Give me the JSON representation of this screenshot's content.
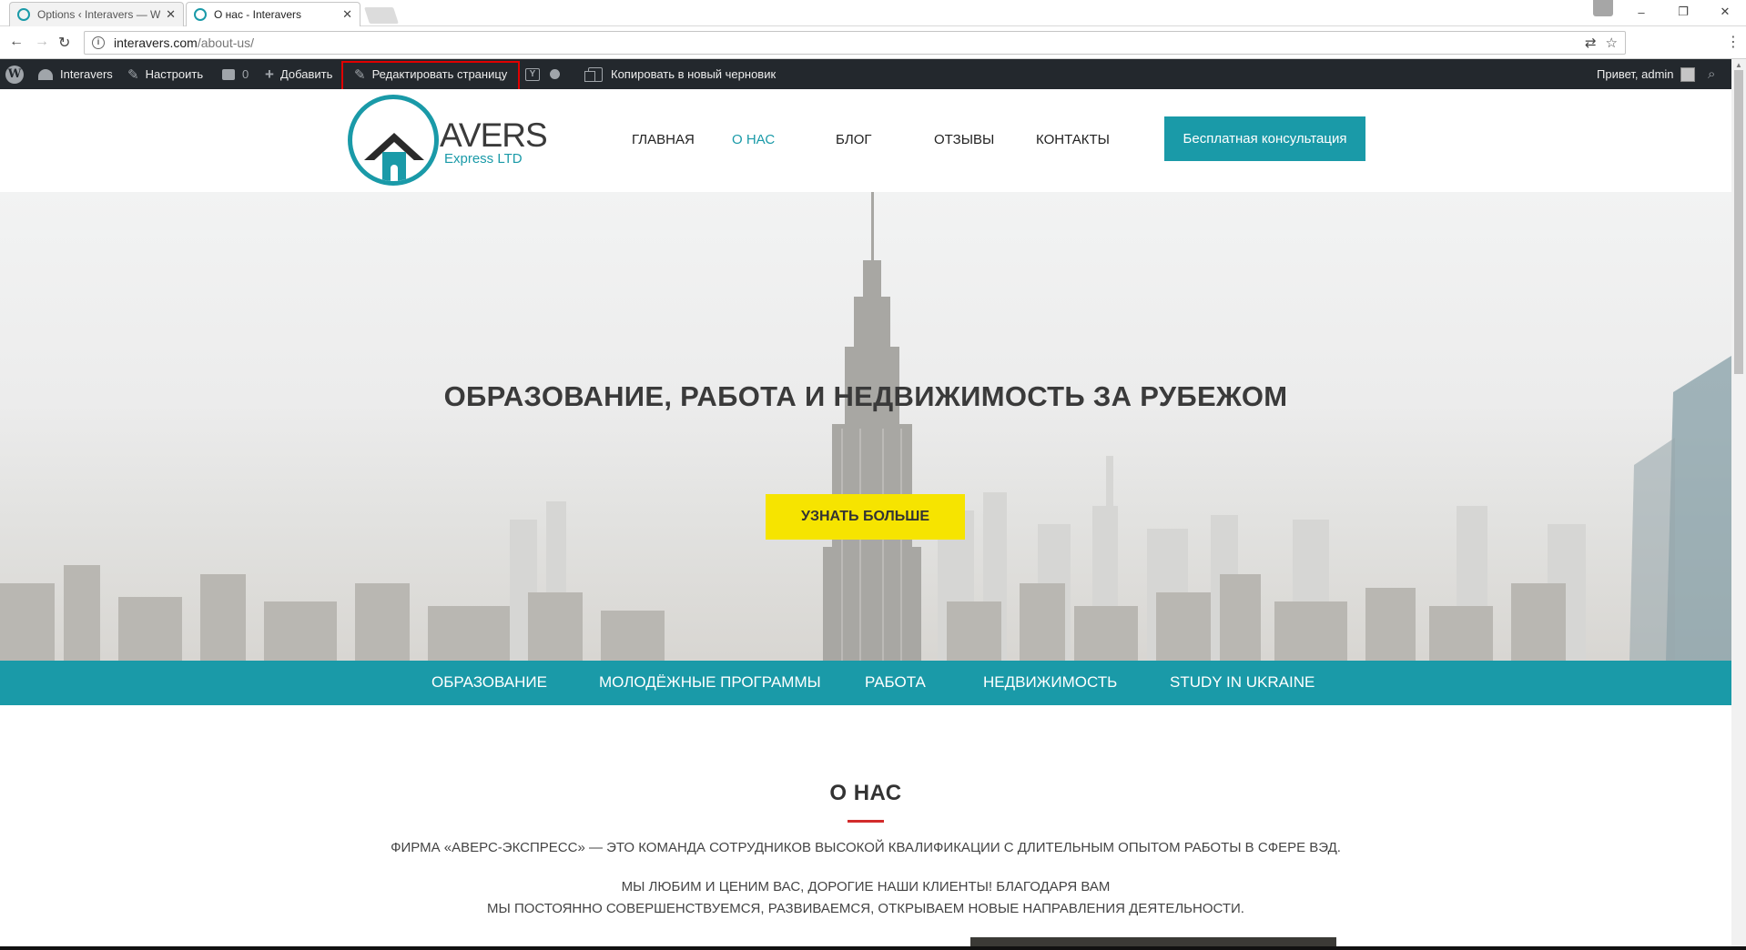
{
  "browser": {
    "tabs": [
      {
        "label": "Options ‹ Interavers — W",
        "close": "✕"
      },
      {
        "label": "О нас - Interavers",
        "close": "✕"
      }
    ],
    "url_host": "interavers.com",
    "url_path": "/about-us/",
    "window_controls": [
      "–",
      "❐",
      "✕"
    ]
  },
  "adminbar": {
    "site_name": "Interavers",
    "customize": "Настроить",
    "comments_count": "0",
    "add_new": "Добавить",
    "edit_page": "Редактировать страницу",
    "copy_draft": "Копировать в новый черновик",
    "greeting": "Привет, admin"
  },
  "logo": {
    "title": "AVERS",
    "subtitle": "Express LTD"
  },
  "nav": {
    "items": [
      "ГЛАВНАЯ",
      "О НАС",
      "БЛОГ",
      "ОТЗЫВЫ",
      "КОНТАКТЫ"
    ],
    "active": "О НАС",
    "cta": "Бесплатная консультация"
  },
  "hero": {
    "title": "ОБРАЗОВАНИЕ, РАБОТА И НЕДВИЖИМОСТЬ ЗА РУБЕЖОМ",
    "button": "УЗНАТЬ БОЛЬШЕ"
  },
  "categories": [
    "ОБРАЗОВАНИЕ",
    "МОЛОДЁЖНЫЕ ПРОГРАММЫ",
    "РАБОТА",
    "НЕДВИЖИМОСТЬ",
    "STUDY IN UKRAINE"
  ],
  "about": {
    "title": "О НАС",
    "p1": "ФИРМА «АВЕРС-ЭКСПРЕСС» — ЭТО КОМАНДА СОТРУДНИКОВ ВЫСОКОЙ КВАЛИФИКАЦИИ С ДЛИТЕЛЬНЫМ ОПЫТОМ РАБОТЫ В СФЕРЕ ВЭД.",
    "p2": "МЫ ЛЮБИМ И ЦЕНИМ ВАС, ДОРОГИЕ НАШИ КЛИЕНТЫ! БЛАГОДАРЯ ВАМ",
    "p3": "МЫ ПОСТОЯННО СОВЕРШЕНСТВУЕМСЯ, РАЗВИВАЕМСЯ, ОТКРЫВАЕМ НОВЫЕ НАПРАВЛЕНИЯ ДЕЯТЕЛЬНОСТИ."
  },
  "colors": {
    "brand_teal": "#1a9aa8",
    "cta_yellow": "#f6e400",
    "admin_bar": "#23282d",
    "accent_red": "#d22b2b"
  }
}
